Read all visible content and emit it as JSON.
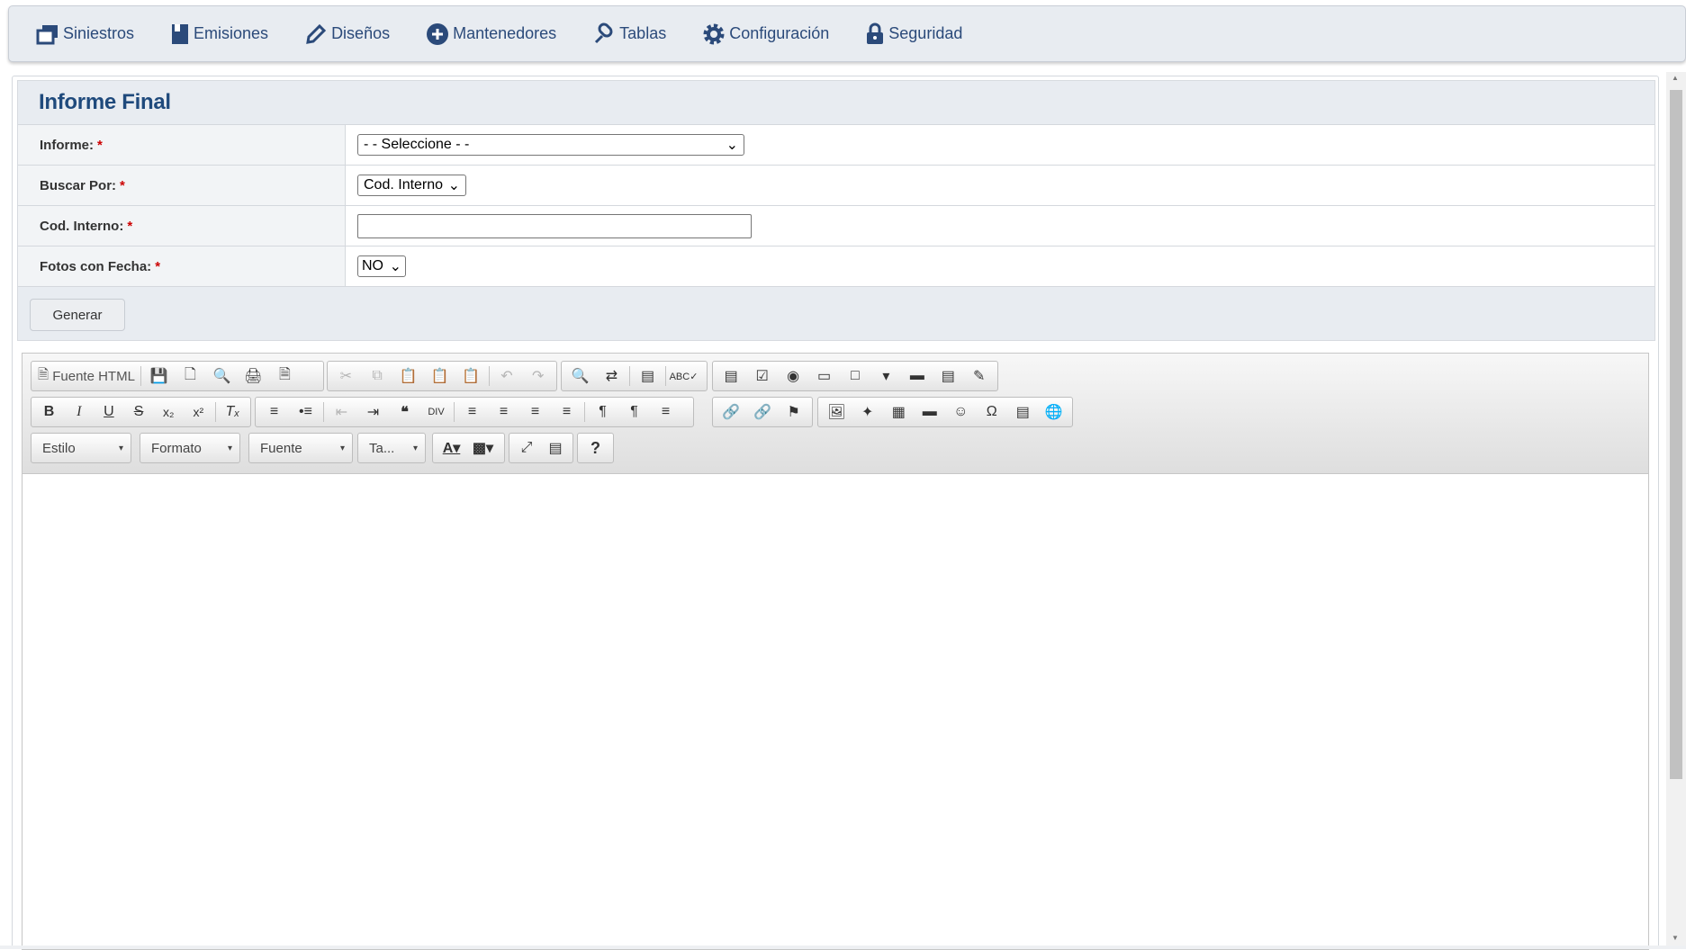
{
  "nav": [
    "Siniestros",
    "Emisiones",
    "Diseños",
    "Mantenedores",
    "Tablas",
    "Configuración",
    "Seguridad"
  ],
  "form": {
    "title": "Informe Final",
    "informe": {
      "label": "Informe:",
      "value": "- - Seleccione - -"
    },
    "buscar": {
      "label": "Buscar Por:",
      "value": "Cod. Interno"
    },
    "cod": {
      "label": "Cod. Interno:",
      "value": ""
    },
    "fotos": {
      "label": "Fotos con Fecha:",
      "value": "NO"
    },
    "req": "*",
    "btn": "Generar"
  },
  "editor": {
    "source": "Fuente HTML",
    "style": "Estilo",
    "format": "Formato",
    "font": "Fuente",
    "size": "Ta..."
  },
  "brand": "#1f4a7c"
}
